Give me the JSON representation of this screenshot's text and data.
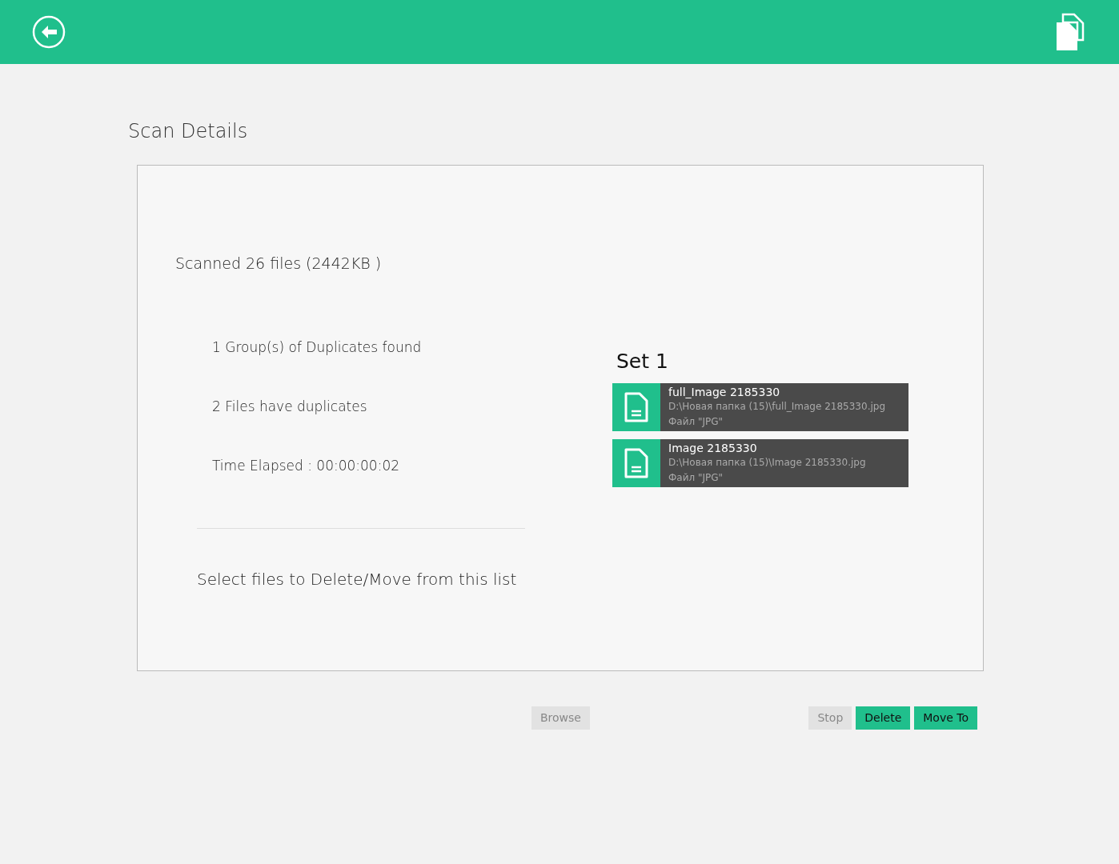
{
  "title": "Scan Details",
  "summary": {
    "scanned": "Scanned 26 files (2442KB )",
    "stats": [
      "1 Group(s) of Duplicates found",
      "2 Files have duplicates",
      "Time Elapsed : 00:00:00:02"
    ],
    "instruction": "Select files to Delete/Move from this list"
  },
  "sets": [
    {
      "title": "Set  1",
      "files": [
        {
          "name": "full_Image 2185330",
          "path": "D:\\Новая папка (15)\\full_Image 2185330.jpg",
          "type": "Файл \"JPG\""
        },
        {
          "name": "Image 2185330",
          "path": "D:\\Новая папка (15)\\Image 2185330.jpg",
          "type": "Файл \"JPG\""
        }
      ]
    }
  ],
  "left_buttons": [
    {
      "label": "Browse",
      "disabled": true
    }
  ],
  "right_buttons": [
    {
      "label": "Stop",
      "disabled": true
    },
    {
      "label": "Delete",
      "disabled": false
    },
    {
      "label": "Move To",
      "disabled": false
    }
  ]
}
